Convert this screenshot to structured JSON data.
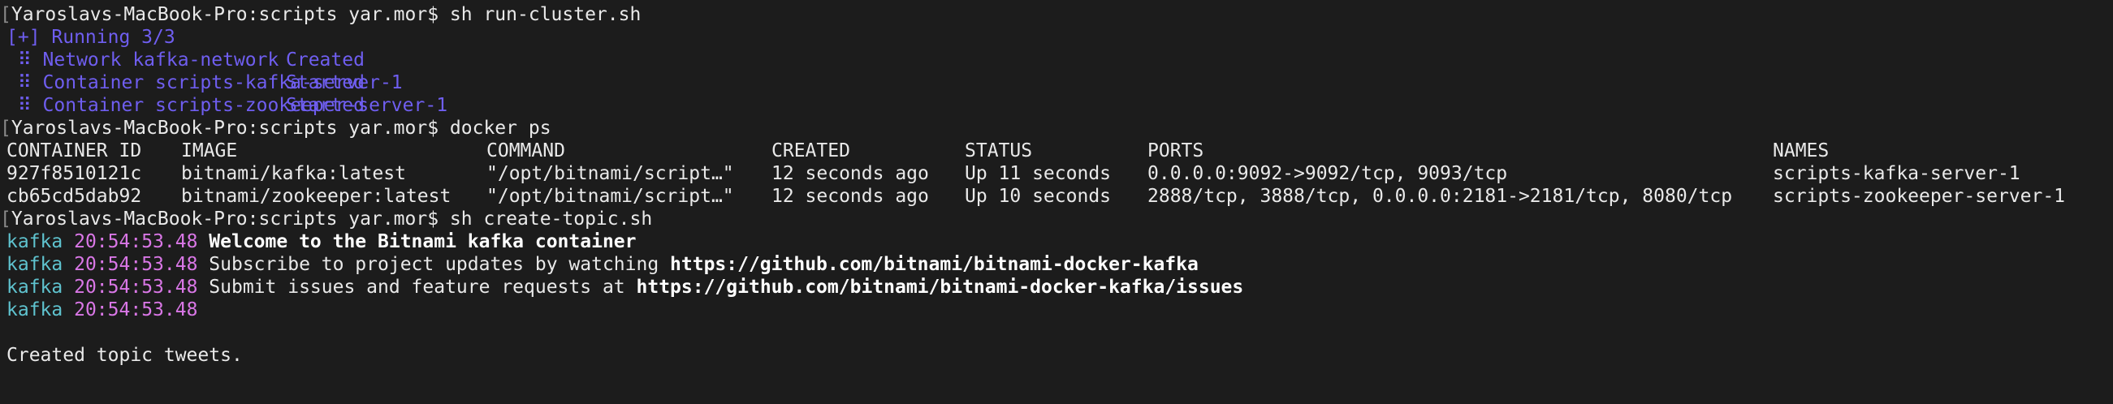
{
  "colors": {
    "purple": "#6f5ef0",
    "cyan": "#5fc3cf",
    "magenta": "#d977e6",
    "bg": "#1c1c1c",
    "fg": "#e9e9e9"
  },
  "cmd1": {
    "prompt": "Yaroslavs-MacBook-Pro:scripts yar.mor$",
    "command": "sh run-cluster.sh"
  },
  "compose": {
    "header": "[+] Running 3/3",
    "items": [
      {
        "name": " ⠿ Network kafka-network",
        "state": "Created"
      },
      {
        "name": " ⠿ Container scripts-kafka-server-1",
        "state": "Started"
      },
      {
        "name": " ⠿ Container scripts-zookeeper-server-1",
        "state": "Started"
      }
    ]
  },
  "cmd2": {
    "prompt": "Yaroslavs-MacBook-Pro:scripts yar.mor$",
    "command": "docker ps"
  },
  "docker": {
    "headers": [
      "CONTAINER ID",
      "IMAGE",
      "COMMAND",
      "CREATED",
      "STATUS",
      "PORTS",
      "NAMES"
    ],
    "rows": [
      [
        "927f8510121c",
        "bitnami/kafka:latest",
        "\"/opt/bitnami/script…\"",
        "12 seconds ago",
        "Up 11 seconds",
        "0.0.0.0:9092->9092/tcp, 9093/tcp",
        "scripts-kafka-server-1"
      ],
      [
        "cb65cd5dab92",
        "bitnami/zookeeper:latest",
        "\"/opt/bitnami/script…\"",
        "12 seconds ago",
        "Up 10 seconds",
        "2888/tcp, 3888/tcp, 0.0.0.0:2181->2181/tcp, 8080/tcp",
        "scripts-zookeeper-server-1"
      ]
    ]
  },
  "cmd3": {
    "prompt": "Yaroslavs-MacBook-Pro:scripts yar.mor$",
    "command": "sh create-topic.sh"
  },
  "kafka_logs": [
    {
      "source": "kafka",
      "time": "20:54:53.48",
      "plain": "",
      "bold": "Welcome to the Bitnami kafka container"
    },
    {
      "source": "kafka",
      "time": "20:54:53.48",
      "plain": "Subscribe to project updates by watching ",
      "bold": "https://github.com/bitnami/bitnami-docker-kafka"
    },
    {
      "source": "kafka",
      "time": "20:54:53.48",
      "plain": "Submit issues and feature requests at ",
      "bold": "https://github.com/bitnami/bitnami-docker-kafka/issues"
    },
    {
      "source": "kafka",
      "time": "20:54:53.48",
      "plain": "",
      "bold": ""
    }
  ],
  "result": "Created topic tweets."
}
